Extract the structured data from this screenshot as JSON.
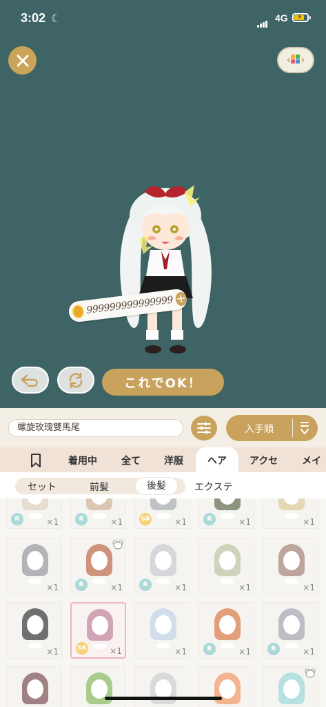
{
  "status": {
    "time": "3:02",
    "network": "4G"
  },
  "item_name": "螺旋玫瑰雙馬尾",
  "coins": {
    "amount": "999999999999999"
  },
  "buttons": {
    "ok": "これでOK！"
  },
  "sort": {
    "label": "入手順"
  },
  "tabs": [
    {
      "label": "着用中"
    },
    {
      "label": "全て"
    },
    {
      "label": "洋服"
    },
    {
      "label": "ヘア"
    },
    {
      "label": "アクセ"
    },
    {
      "label": "メイク"
    }
  ],
  "subtabs": [
    {
      "label": "セット"
    },
    {
      "label": "前髪"
    },
    {
      "label": "後髪"
    },
    {
      "label": "エクステ"
    }
  ],
  "count_label": "×1",
  "rows": [
    [
      {
        "rarity": "R",
        "hair": "#d9c9b7"
      },
      {
        "rarity": "R",
        "hair": "#c8a88a"
      },
      {
        "rarity": "SR",
        "hair": "#9ea3a7"
      },
      {
        "rarity": "R",
        "hair": "#4f5b3a"
      },
      {
        "rarity": "",
        "hair": "#d8c58e"
      }
    ],
    [
      {
        "rarity": "",
        "hair": "#8d8d93"
      },
      {
        "rarity": "R",
        "hair": "#b45a33",
        "bear": true
      },
      {
        "rarity": "R",
        "hair": "#c0c2c6"
      },
      {
        "rarity": "",
        "hair": "#b4bd98"
      },
      {
        "rarity": "",
        "hair": "#9b7666"
      }
    ],
    [
      {
        "rarity": "",
        "hair": "#262426"
      },
      {
        "rarity": "SR",
        "hair": "#b9768e",
        "selected": true
      },
      {
        "rarity": "",
        "hair": "#b8cbe0"
      },
      {
        "rarity": "R",
        "hair": "#d56a34"
      },
      {
        "rarity": "R",
        "hair": "#9b9aa6"
      }
    ],
    [
      {
        "rarity": "",
        "hair": "#6d3f44"
      },
      {
        "rarity": "",
        "hair": "#7bb14f"
      },
      {
        "rarity": "",
        "hair": "#c6c6c6"
      },
      {
        "rarity": "",
        "hair": "#ef8d55"
      },
      {
        "rarity": "",
        "hair": "#8fd2d0",
        "bear": true
      }
    ]
  ]
}
